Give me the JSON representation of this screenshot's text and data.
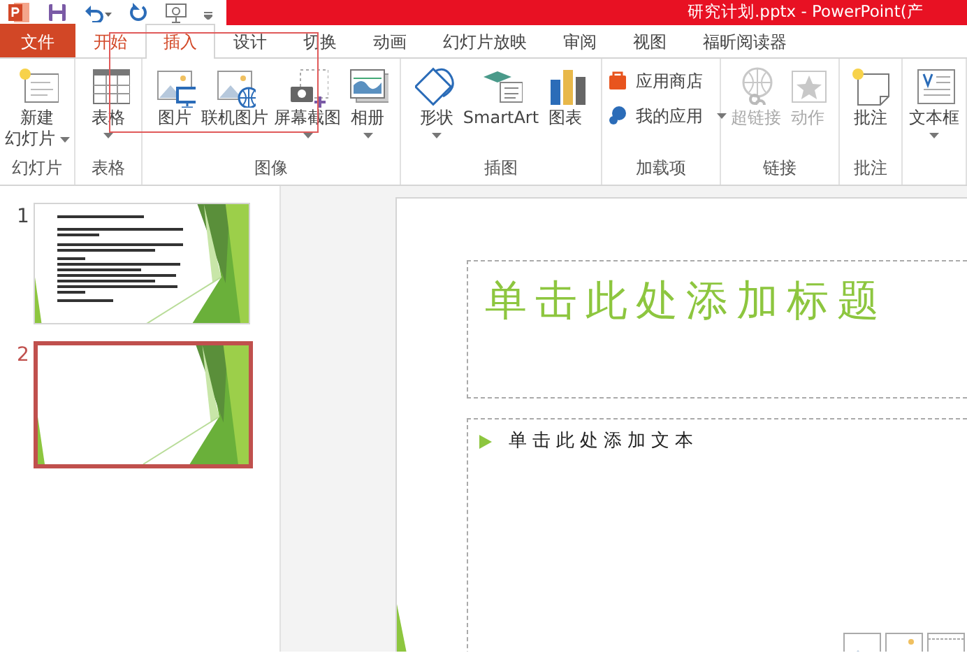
{
  "window": {
    "title": "研究计划.pptx - PowerPoint(产"
  },
  "tabs": [
    {
      "label": "文件",
      "kind": "file",
      "selected": false
    },
    {
      "label": "开始",
      "kind": "tab",
      "selected": false
    },
    {
      "label": "插入",
      "kind": "tab",
      "selected": true
    },
    {
      "label": "设计",
      "kind": "tab",
      "selected": false
    },
    {
      "label": "切换",
      "kind": "tab",
      "selected": false
    },
    {
      "label": "动画",
      "kind": "tab",
      "selected": false
    },
    {
      "label": "幻灯片放映",
      "kind": "tab",
      "selected": false
    },
    {
      "label": "审阅",
      "kind": "tab",
      "selected": false
    },
    {
      "label": "视图",
      "kind": "tab",
      "selected": false
    },
    {
      "label": "福昕阅读器",
      "kind": "tab",
      "selected": false
    }
  ],
  "highlight_box": true,
  "ribbon": [
    {
      "label": "幻灯片",
      "buttons": [
        {
          "label": "新建",
          "label_2": "幻灯片",
          "kind": "new-slide",
          "dropdown": true,
          "disabled": false
        }
      ]
    },
    {
      "label": "表格",
      "buttons": [
        {
          "label": "表格",
          "kind": "table",
          "dropdown": true,
          "disabled": false
        }
      ]
    },
    {
      "label": "图像",
      "buttons": [
        {
          "label": "图片",
          "kind": "picture",
          "dropdown": false,
          "disabled": false
        },
        {
          "label": "联机图片",
          "kind": "online-picture",
          "dropdown": false,
          "disabled": false
        },
        {
          "label": "屏幕截图",
          "kind": "screenshot",
          "dropdown": true,
          "disabled": false
        },
        {
          "label": "相册",
          "kind": "album",
          "dropdown": true,
          "disabled": false
        }
      ]
    },
    {
      "label": "插图",
      "buttons": [
        {
          "label": "形状",
          "kind": "shapes",
          "dropdown": true,
          "disabled": false
        },
        {
          "label": "SmartArt",
          "kind": "smartart",
          "dropdown": false,
          "disabled": false
        },
        {
          "label": "图表",
          "kind": "chart",
          "dropdown": false,
          "disabled": false
        }
      ]
    },
    {
      "label": "加载项",
      "small_buttons": [
        {
          "label": "应用商店",
          "kind": "store",
          "dropdown": false
        },
        {
          "label": "我的应用",
          "kind": "apps",
          "dropdown": true
        }
      ]
    },
    {
      "label": "链接",
      "buttons": [
        {
          "label": "超链接",
          "kind": "hyperlink",
          "dropdown": false,
          "disabled": true
        },
        {
          "label": "动作",
          "kind": "action",
          "dropdown": false,
          "disabled": true
        }
      ]
    },
    {
      "label": "批注",
      "buttons": [
        {
          "label": "批注",
          "kind": "comment",
          "dropdown": false,
          "disabled": false
        }
      ]
    },
    {
      "buttons": [
        {
          "label": "文本框",
          "kind": "textbox",
          "dropdown": true,
          "disabled": false
        }
      ]
    }
  ],
  "slides": [
    {
      "number": "1",
      "kind": "text",
      "selected": false
    },
    {
      "number": "2",
      "kind": "blank",
      "selected": true
    }
  ],
  "slide": {
    "title_placeholder": "单击此处添加标题",
    "body_placeholder": "单击此处添加文本"
  }
}
